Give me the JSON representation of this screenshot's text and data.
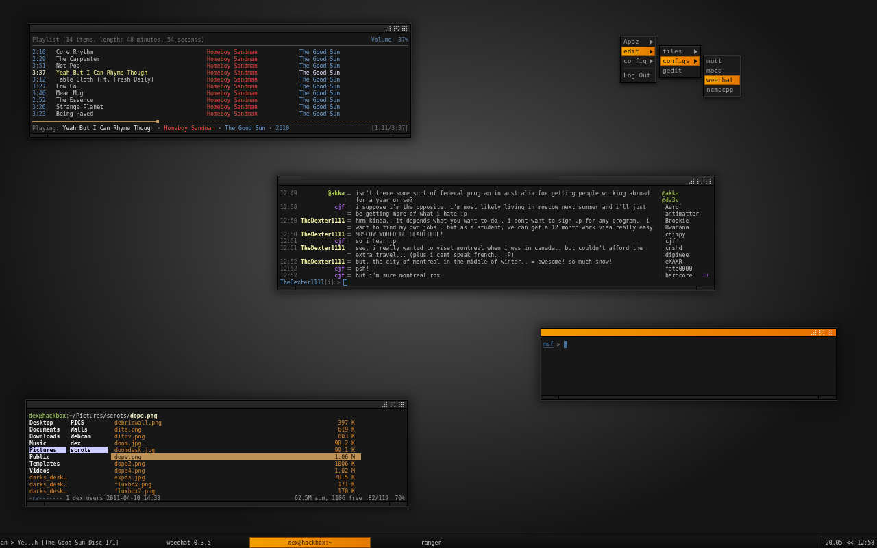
{
  "playlist": {
    "focused": false,
    "header": "Playlist (14 items, length: 48 minutes, 54 seconds)",
    "volume": "Volume: 37%",
    "rows": [
      {
        "time": "2:10",
        "title": "Core Rhythm",
        "artist": "Homeboy Sandman",
        "album": "The Good Sun",
        "playing": false
      },
      {
        "time": "2:29",
        "title": "The Carpenter",
        "artist": "Homeboy Sandman",
        "album": "The Good Sun",
        "playing": false
      },
      {
        "time": "3:51",
        "title": "Not Pop",
        "artist": "Homeboy Sandman",
        "album": "The Good Sun",
        "playing": false
      },
      {
        "time": "3:37",
        "title": "Yeah But I Can Rhyme Though",
        "artist": "Homeboy Sandman",
        "album": "The Good Sun",
        "playing": true
      },
      {
        "time": "3:12",
        "title": "Table Cloth (Ft. Fresh Daily)",
        "artist": "Homeboy Sandman",
        "album": "The Good Sun",
        "playing": false
      },
      {
        "time": "3:27",
        "title": "Low Co.",
        "artist": "Homeboy Sandman",
        "album": "The Good Sun",
        "playing": false
      },
      {
        "time": "3:46",
        "title": "Mean Mug",
        "artist": "Homeboy Sandman",
        "album": "The Good Sun",
        "playing": false
      },
      {
        "time": "2:52",
        "title": "The Essence",
        "artist": "Homeboy Sandman",
        "album": "The Good Sun",
        "playing": false
      },
      {
        "time": "3:26",
        "title": "Strange Planet",
        "artist": "Homeboy Sandman",
        "album": "The Good Sun",
        "playing": false
      },
      {
        "time": "3:23",
        "title": "Being Haved",
        "artist": "Homeboy Sandman",
        "album": "The Good Sun",
        "playing": false
      }
    ],
    "progress": {
      "level": 0.33
    },
    "now_playing": [
      {
        "kind": "label",
        "text": "Playing:"
      },
      {
        "kind": "title",
        "text": "Yeah But I Can Rhyme Though"
      },
      {
        "kind": "separator",
        "text": "·"
      },
      {
        "kind": "artist",
        "text": "Homeboy Sandman"
      },
      {
        "kind": "separator",
        "text": "·"
      },
      {
        "kind": "album",
        "text": "The Good Sun"
      },
      {
        "kind": "separator",
        "text": "·"
      },
      {
        "kind": "year",
        "text": "2010"
      }
    ],
    "elapsed": "[1:11/3:37]"
  },
  "menus": [
    {
      "items": [
        {
          "kind": "item",
          "label": "Appz",
          "has_submenu": true,
          "selected": false
        },
        {
          "kind": "item",
          "label": "edit",
          "has_submenu": true,
          "selected": true
        },
        {
          "kind": "item",
          "label": "config",
          "has_submenu": true,
          "selected": false
        },
        {
          "kind": "separator"
        },
        {
          "kind": "item",
          "label": "Log Out",
          "has_submenu": false,
          "selected": false
        }
      ]
    },
    {
      "items": [
        {
          "kind": "item",
          "label": "files",
          "has_submenu": true,
          "selected": false
        },
        {
          "kind": "item",
          "label": "configs",
          "has_submenu": true,
          "selected": true
        },
        {
          "kind": "item",
          "label": "gedit",
          "has_submenu": false,
          "selected": false
        }
      ]
    },
    {
      "items": [
        {
          "kind": "item",
          "label": "mutt",
          "has_submenu": false,
          "selected": false
        },
        {
          "kind": "item",
          "label": "mocp",
          "has_submenu": false,
          "selected": false
        },
        {
          "kind": "item",
          "label": "weechat",
          "has_submenu": false,
          "selected": true
        },
        {
          "kind": "item",
          "label": "ncmpcpp",
          "has_submenu": false,
          "selected": false
        }
      ]
    }
  ],
  "chat": {
    "focused": false,
    "messages": [
      {
        "time": "12:49",
        "nick": "@akka",
        "color": "#a8c850",
        "lines": [
          "isn't there some sort of federal program in australia for getting people working abroad",
          "for a year or so?"
        ]
      },
      {
        "time": "12:50",
        "nick": "cjf",
        "color": "#a868e0",
        "lines": [
          "i suppose i'm the opposite. i'm most likely living in moscow next summer and i'll just",
          "be getting more of what i hate :p"
        ]
      },
      {
        "time": "12:50",
        "nick": "TheDexter1111",
        "color": "#f0f0a0",
        "lines": [
          "hmm kinda.. it depends what you want to do.. i dont want to sign up for any program.. i",
          "want to find my own jobs.. but as a student, we can get a 12 month work visa really easy"
        ]
      },
      {
        "time": "12:50",
        "nick": "TheDexter1111",
        "color": "#f0f0a0",
        "lines": [
          "MOSCOW WOULD BE BEAUTIFUL!"
        ]
      },
      {
        "time": "12:51",
        "nick": "cjf",
        "color": "#a868e0",
        "lines": [
          "so i hear :p"
        ]
      },
      {
        "time": "12:51",
        "nick": "TheDexter1111",
        "color": "#f0f0a0",
        "lines": [
          "see, i really wanted to viset montreal when i was in canada.. but couldn't afford the",
          "extra travel... (plus i cant speak french.. :P)"
        ]
      },
      {
        "time": "12:52",
        "nick": "TheDexter1111",
        "color": "#f0f0a0",
        "lines": [
          "but, the city of montreal in the middle of winter.. = awesome! so much snow!"
        ]
      },
      {
        "time": "12:52",
        "nick": "cjf",
        "color": "#a868e0",
        "lines": [
          "psh!"
        ]
      },
      {
        "time": "12:52",
        "nick": "cjf",
        "color": "#a868e0",
        "lines": [
          "but i'm sure montreal rox"
        ]
      }
    ],
    "nicklist": [
      {
        "nick": "@akka",
        "op": true
      },
      {
        "nick": "@da3v",
        "op": true
      },
      {
        "nick": "Aero`",
        "op": false
      },
      {
        "nick": "antimatter-",
        "op": false
      },
      {
        "nick": "Brookie",
        "op": false
      },
      {
        "nick": "Bwanana",
        "op": false
      },
      {
        "nick": "chimpy",
        "op": false
      },
      {
        "nick": "cjf",
        "op": false
      },
      {
        "nick": "crshd",
        "op": false
      },
      {
        "nick": "dipiwee",
        "op": false
      },
      {
        "nick": "eXAKR",
        "op": false
      },
      {
        "nick": "fate0000",
        "op": false
      },
      {
        "nick": "hardcore",
        "op": false
      }
    ],
    "nicklist_more": "++",
    "input": {
      "nick": "TheDexter1111",
      "mode": "(i)",
      "prompt": ">"
    }
  },
  "terminal": {
    "focused": true,
    "prompt": "msf",
    "prompt_symbol": ">"
  },
  "file_manager": {
    "focused": false,
    "path": {
      "host": "dex@hackbox:",
      "dir": "~/Pictures/scrots/",
      "file": "dope.png"
    },
    "parent": [
      {
        "name": "Desktop",
        "kind": "dir",
        "selected": false
      },
      {
        "name": "Documents",
        "kind": "dir",
        "selected": false
      },
      {
        "name": "Downloads",
        "kind": "dir",
        "selected": false
      },
      {
        "name": "Music",
        "kind": "dir",
        "selected": false
      },
      {
        "name": "Pictures",
        "kind": "dir",
        "selected": true
      },
      {
        "name": "Public",
        "kind": "dir",
        "selected": false
      },
      {
        "name": "Templates",
        "kind": "dir",
        "selected": false
      },
      {
        "name": "Videos",
        "kind": "dir",
        "selected": false
      },
      {
        "name": "darks_desk…",
        "kind": "file",
        "selected": false
      },
      {
        "name": "darks_desk…",
        "kind": "file",
        "selected": false
      },
      {
        "name": "darks_desk…",
        "kind": "file",
        "selected": false
      }
    ],
    "current": [
      {
        "name": "PICS",
        "kind": "dir",
        "selected": false
      },
      {
        "name": "Walls",
        "kind": "dir",
        "selected": false
      },
      {
        "name": "Webcam",
        "kind": "dir",
        "selected": false
      },
      {
        "name": "dex",
        "kind": "dir",
        "selected": false
      },
      {
        "name": "scrots",
        "kind": "dir",
        "selected": true
      }
    ],
    "files": [
      {
        "name": "debriswall.png",
        "size": "397 K",
        "selected": false
      },
      {
        "name": "dita.png",
        "size": "619 K",
        "selected": false
      },
      {
        "name": "ditav.png",
        "size": "603 K",
        "selected": false
      },
      {
        "name": "doom.jpg",
        "size": "98.2 K",
        "selected": false
      },
      {
        "name": "doomdesk.jpg",
        "size": "99.1 K",
        "selected": false
      },
      {
        "name": "dope.png",
        "size": "1.06 M",
        "selected": true
      },
      {
        "name": "dope2.png",
        "size": "1006 K",
        "selected": false
      },
      {
        "name": "dope4.png",
        "size": "1.02 M",
        "selected": false
      },
      {
        "name": "expos.jpg",
        "size": "78.5 K",
        "selected": false
      },
      {
        "name": "fluxbox.png",
        "size": "171 K",
        "selected": false
      },
      {
        "name": "fluxbox2.png",
        "size": "170 K",
        "selected": false
      }
    ],
    "status": {
      "permissions": "-rw-------",
      "details": "1 dex users 2011-04-10 14:33",
      "disk": "62.5M sum, 110G free",
      "position": "82/119",
      "percent": "70%"
    }
  },
  "taskbar": {
    "now_playing": "an > Ye...h [The Good Sun Disc 1/1]",
    "tasks": [
      {
        "label": "weechat 0.3.5",
        "selected": false
      },
      {
        "label": "dex@hackbox:~",
        "selected": true
      },
      {
        "label": "ranger",
        "selected": false
      }
    ],
    "date": "20.05",
    "divider": "<<",
    "clock": "12:58"
  }
}
